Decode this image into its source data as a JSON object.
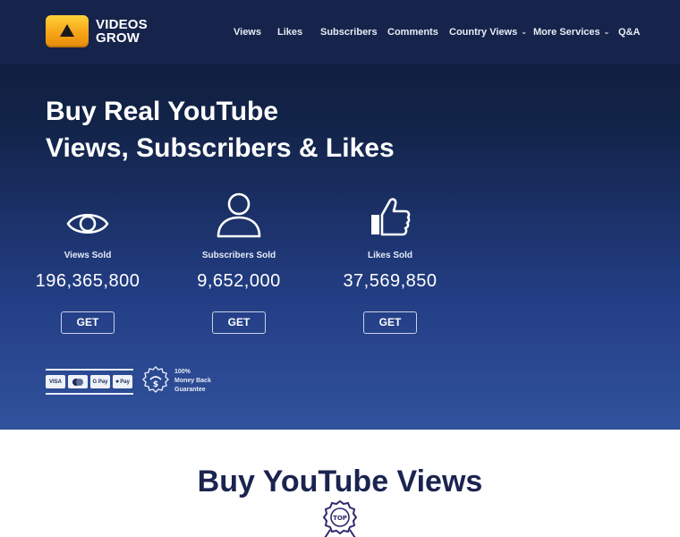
{
  "brand": {
    "line1": "VIDEOS",
    "line2": "GROW"
  },
  "nav": {
    "items": [
      {
        "label": "Views"
      },
      {
        "label": "Likes"
      },
      {
        "label": "Subscribers"
      },
      {
        "label": "Comments"
      },
      {
        "label": "Country Views",
        "dropdown": true
      },
      {
        "label": "More Services",
        "dropdown": true
      },
      {
        "label": "Q&A"
      }
    ]
  },
  "hero": {
    "title_line1": "Buy Real YouTube",
    "title_line2": "Views, Subscribers & Likes"
  },
  "stats": [
    {
      "icon": "eye-icon",
      "label": "Views Sold",
      "count": "196,365,800",
      "button": "GET"
    },
    {
      "icon": "user-icon",
      "label": "Subscribers Sold",
      "count": "9,652,000",
      "button": "GET"
    },
    {
      "icon": "thumbs-up-icon",
      "label": "Likes Sold",
      "count": "37,569,850",
      "button": "GET"
    }
  ],
  "payments": {
    "cards": [
      "VISA",
      "MC",
      "G Pay",
      "Pay"
    ]
  },
  "guarantee": {
    "line1": "100%",
    "line2": "Money Back",
    "line3": "Guarantee"
  },
  "section": {
    "title": "Buy YouTube Views",
    "badge": "TOP"
  },
  "colors": {
    "accent": "#f6a417",
    "navy": "#16234a",
    "title": "#1b2450"
  }
}
